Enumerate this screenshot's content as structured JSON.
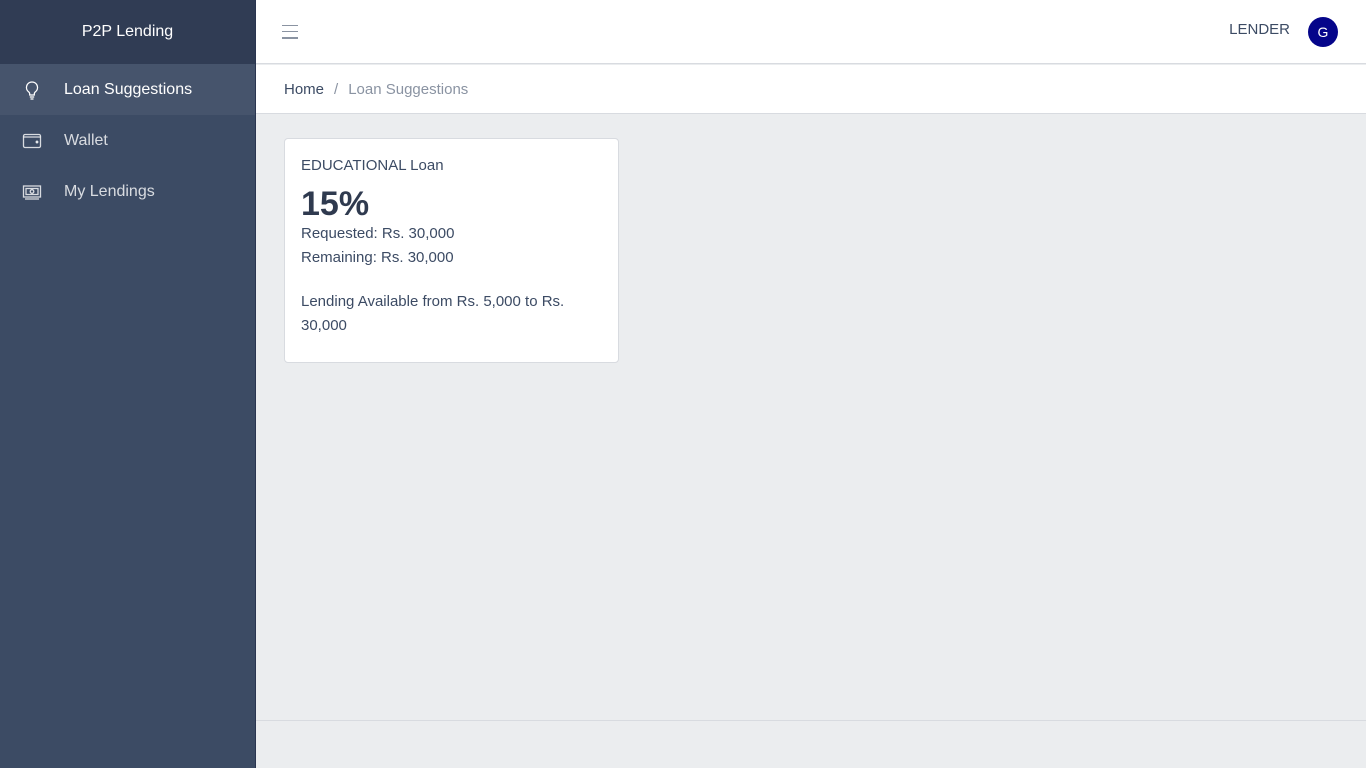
{
  "app": {
    "brand": "P2P Lending"
  },
  "sidebar": {
    "items": [
      {
        "label": "Loan Suggestions",
        "icon": "lightbulb-icon",
        "active": true
      },
      {
        "label": "Wallet",
        "icon": "wallet-icon",
        "active": false
      },
      {
        "label": "My Lendings",
        "icon": "money-icon",
        "active": false
      }
    ]
  },
  "header": {
    "role": "LENDER",
    "avatar_initial": "G"
  },
  "breadcrumb": {
    "home": "Home",
    "separator": "/",
    "current": "Loan Suggestions"
  },
  "loans": [
    {
      "title": "EDUCATIONAL Loan",
      "rate": "15%",
      "requested": "Requested: Rs. 30,000",
      "remaining": "Remaining: Rs. 30,000",
      "lending_range": "Lending Available from Rs. 5,000 to Rs. 30,000"
    }
  ],
  "colors": {
    "sidebar_bg": "#3c4b64",
    "brand_bg": "#303c54",
    "avatar_bg": "#05058a",
    "page_bg": "#ebedef"
  }
}
